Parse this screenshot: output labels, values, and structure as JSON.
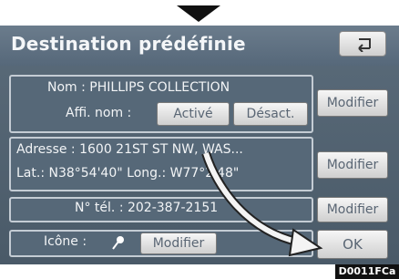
{
  "title": "Destination prédéfinie",
  "name_row": {
    "label": "Nom : PHILLIPS COLLECTION",
    "display_label": "Affi. nom :",
    "active_label": "Activé",
    "inactive_label": "Désact.",
    "modify_label": "Modifier"
  },
  "address_row": {
    "address": "Adresse : 1600 21ST ST NW, WAS...",
    "coords": "Lat.: N38°54'40\"  Long.: W77°2'48\"",
    "modify_label": "Modifier"
  },
  "phone_row": {
    "phone": "N° tél. : 202-387-2151",
    "modify_label": "Modifier"
  },
  "icon_row": {
    "label": "Icône :",
    "icon": "pin-icon",
    "modify_label": "Modifier"
  },
  "ok_label": "OK",
  "figure_code": "D0011FCa",
  "colors": {
    "screen_bg": "#56687a",
    "button_bg": "#e8e8e8"
  }
}
